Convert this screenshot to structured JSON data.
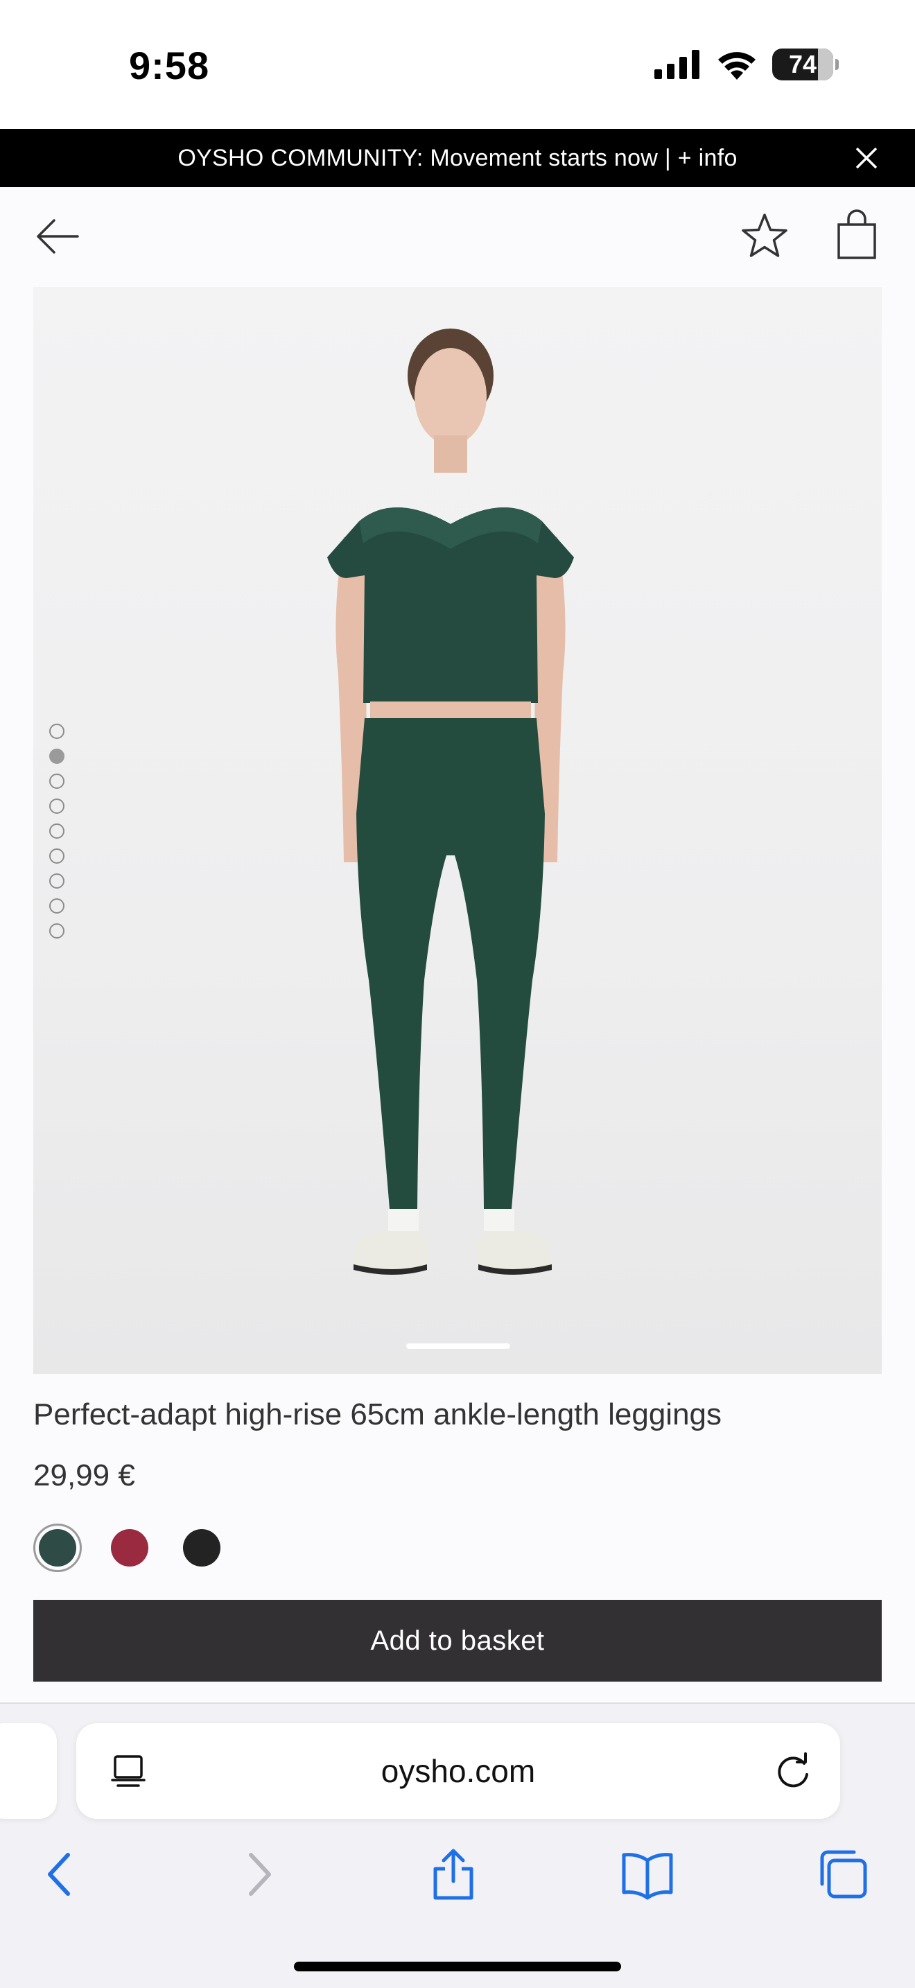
{
  "status_bar": {
    "time": "9:58",
    "battery": "74"
  },
  "promo": {
    "text": "OYSHO COMMUNITY: Movement starts now | + info"
  },
  "header": {
    "icons": [
      "back-arrow-icon",
      "star-icon",
      "shopping-bag-icon"
    ]
  },
  "gallery": {
    "image_count": 9,
    "active_index": 1
  },
  "product": {
    "title": "Perfect-adapt high-rise 65cm ankle-length leggings",
    "price": "29,99 €",
    "colors": [
      {
        "name": "green",
        "hex": "#2f4b45",
        "selected": true
      },
      {
        "name": "red",
        "hex": "#9a2a40",
        "selected": false
      },
      {
        "name": "black",
        "hex": "#232323",
        "selected": false
      }
    ],
    "cta": "Add to basket"
  },
  "browser": {
    "url": "oysho.com",
    "accent": "#1f6fe6"
  }
}
